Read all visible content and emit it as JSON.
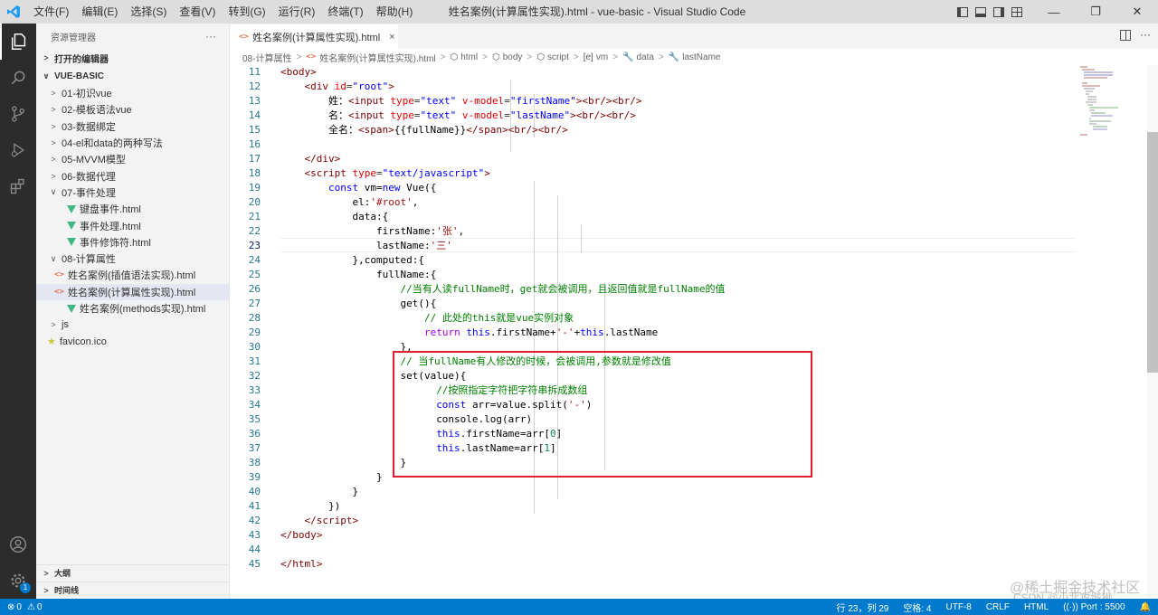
{
  "titlebar": {
    "menu": [
      "文件(F)",
      "编辑(E)",
      "选择(S)",
      "查看(V)",
      "转到(G)",
      "运行(R)",
      "终端(T)",
      "帮助(H)"
    ],
    "title": "姓名案例(计算属性实现).html - vue-basic - Visual Studio Code"
  },
  "sidebar": {
    "header": "资源管理器",
    "more": "···",
    "open_editors": "打开的编辑器",
    "project": "VUE-BASIC",
    "folders": [
      {
        "label": "01-初识vue",
        "expanded": false
      },
      {
        "label": "02-模板语法vue",
        "expanded": false
      },
      {
        "label": "03-数据绑定",
        "expanded": false
      },
      {
        "label": "04-el和data的两种写法",
        "expanded": false
      },
      {
        "label": "05-MVVM模型",
        "expanded": false
      },
      {
        "label": "06-数据代理",
        "expanded": false
      },
      {
        "label": "07-事件处理",
        "expanded": true
      }
    ],
    "files_07": [
      "键盘事件.html",
      "事件处理.html",
      "事件修饰符.html"
    ],
    "folder_08": "08-计算属性",
    "files_08": [
      "姓名案例(插值语法实现).html",
      "姓名案例(计算属性实现).html",
      "姓名案例(methods实现).html"
    ],
    "folder_js": "js",
    "favicon": "favicon.ico",
    "outline": "大纲",
    "timeline": "时间线"
  },
  "tab": {
    "label": "姓名案例(计算属性实现).html",
    "close": "×"
  },
  "breadcrumbs": [
    "08-计算属性",
    "姓名案例(计算属性实现).html",
    "html",
    "body",
    "script",
    "vm",
    "data",
    "lastName"
  ],
  "statusbar": {
    "errors": "0",
    "warnings": "0",
    "position": "行 23，列 29",
    "spaces": "空格: 4",
    "encoding": "UTF-8",
    "eol": "CRLF",
    "language": "HTML",
    "port": "Port : 5500"
  },
  "watermark": {
    "line1": "@稀土掘金技术社区",
    "line2": "CSDN @小北攻城狮"
  },
  "colors": {
    "accent": "#007acc",
    "highlight_box": "#e0202a",
    "activity_bar": "#2c2c2c"
  }
}
